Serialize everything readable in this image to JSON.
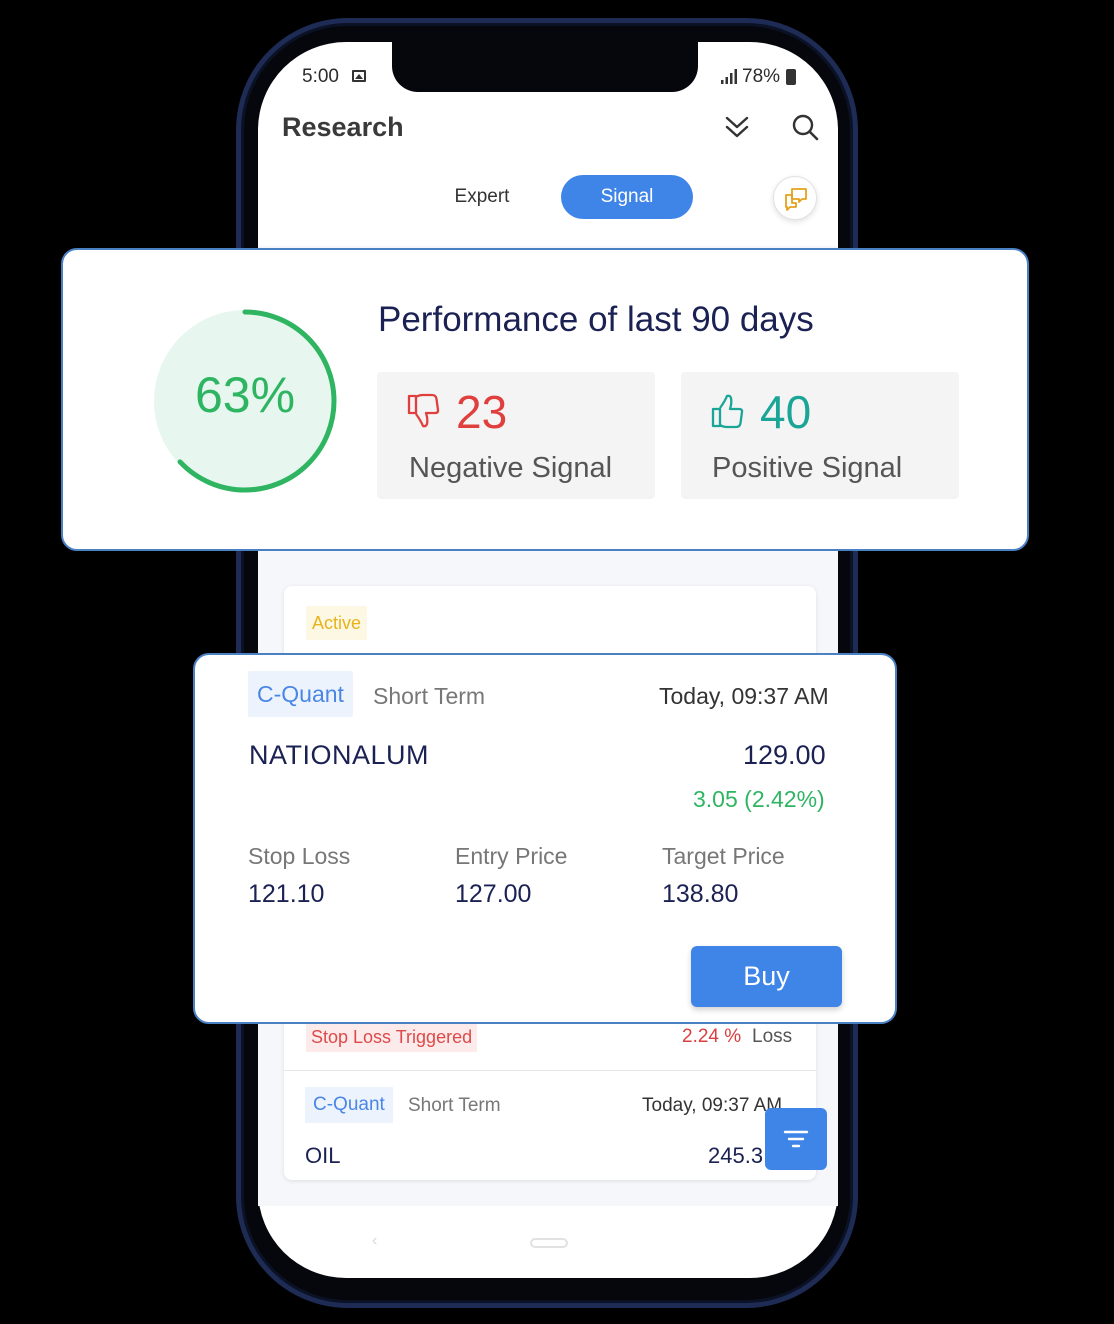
{
  "status_bar": {
    "time": "5:00",
    "battery": "78%"
  },
  "header": {
    "title": "Research"
  },
  "tabs": {
    "expert": "Expert",
    "signal": "Signal",
    "active_tab": "Signal"
  },
  "performance": {
    "title": "Performance of last 90 days",
    "percent_label": "63%",
    "percent_value": 0.63,
    "negative": {
      "count": "23",
      "label": "Negative Signal",
      "color": "#e0403d"
    },
    "positive": {
      "count": "40",
      "label": "Positive Signal",
      "color": "#1aa597"
    }
  },
  "active_section": {
    "badge": "Active"
  },
  "signal_card": {
    "tag": "C-Quant",
    "term": "Short Term",
    "time": "Today, 09:37 AM",
    "symbol": "NATIONALUM",
    "price": "129.00",
    "change": "3.05 (2.42%)",
    "stop_loss_label": "Stop Loss",
    "stop_loss_value": "121.10",
    "entry_label": "Entry Price",
    "entry_value": "127.00",
    "target_label": "Target Price",
    "target_value": "138.80",
    "buy_label": "Buy"
  },
  "triggered_row": {
    "badge": "Stop Loss Triggered",
    "pct": "2.24 %",
    "suffix": "Loss"
  },
  "second_row": {
    "tag": "C-Quant",
    "term": "Short Term",
    "time": "Today, 09:37 AM",
    "symbol": "OIL",
    "price": "245.3"
  },
  "nav": {
    "back": "‹"
  },
  "colors": {
    "accent": "#3f85e8",
    "positive": "#2fb562",
    "card_border": "#4a80c4"
  }
}
